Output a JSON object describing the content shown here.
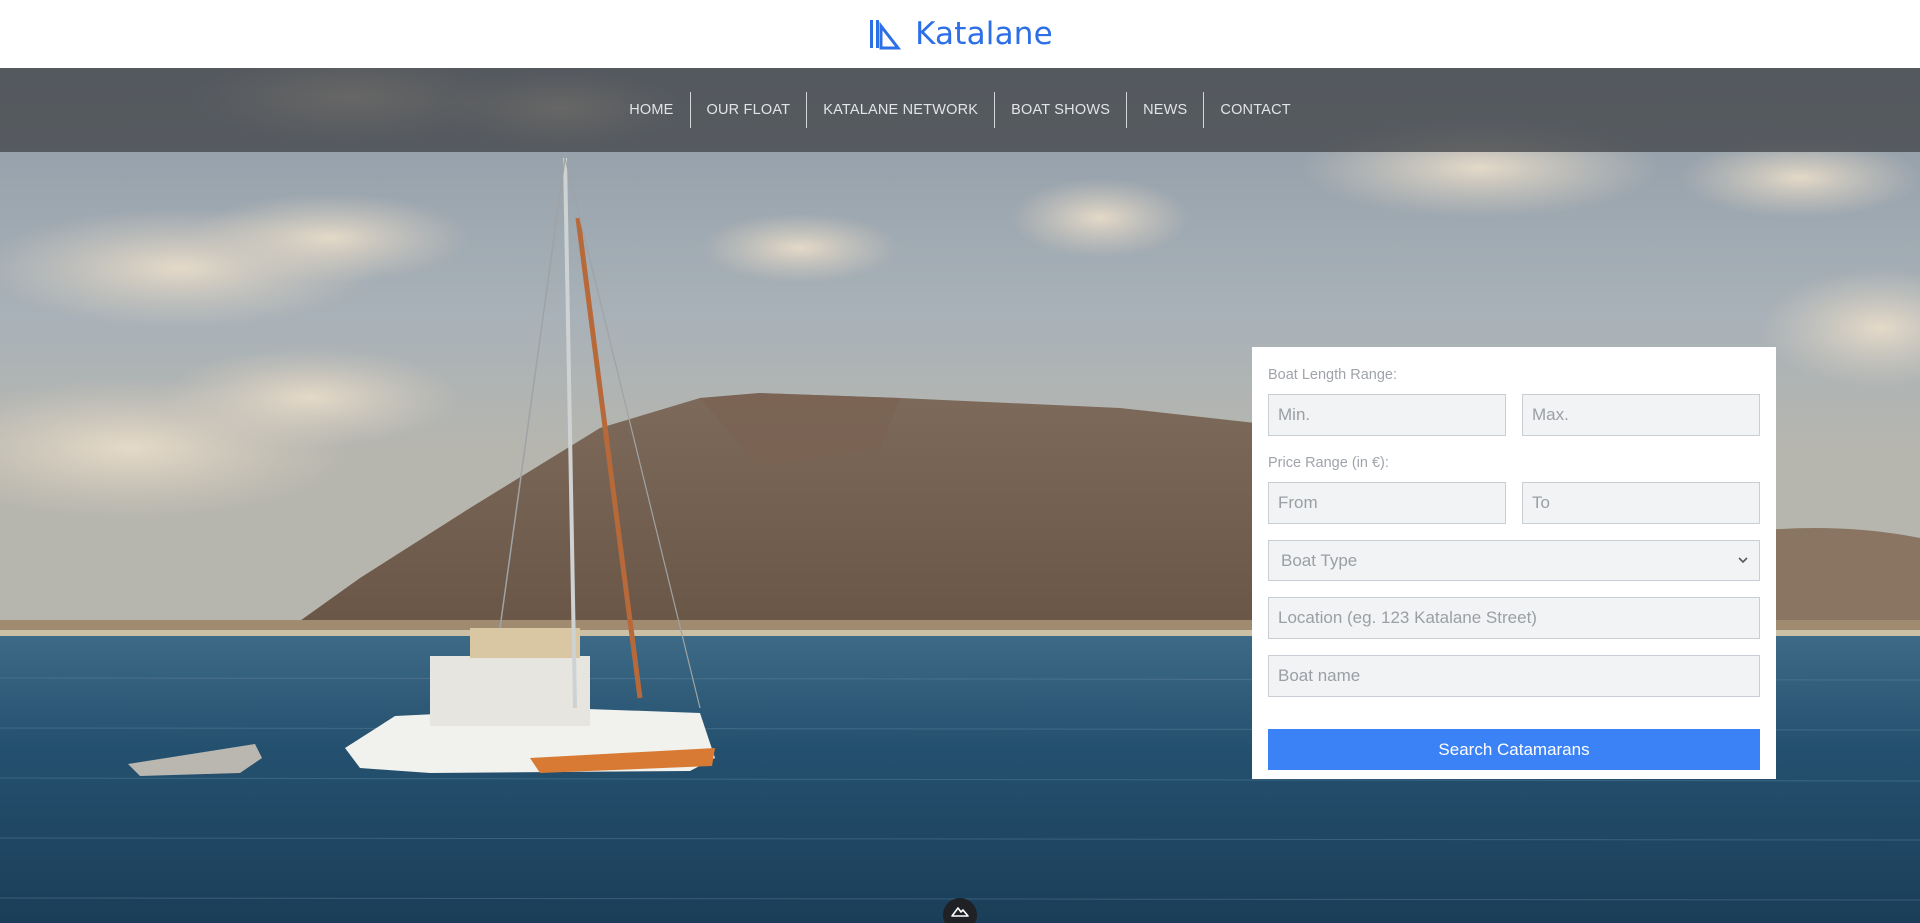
{
  "brand": {
    "name": "Katalane",
    "logo_icon": "katalane-sail-logo-icon",
    "color": "#2c6fe6"
  },
  "nav": {
    "items": [
      {
        "label": "HOME"
      },
      {
        "label": "OUR FLOAT"
      },
      {
        "label": "KATALANE NETWORK"
      },
      {
        "label": "BOAT SHOWS"
      },
      {
        "label": "NEWS"
      },
      {
        "label": "CONTACT"
      }
    ]
  },
  "search": {
    "length_label": "Boat Length Range:",
    "length_min_placeholder": "Min.",
    "length_max_placeholder": "Max.",
    "price_label": "Price Range (in €):",
    "price_from_placeholder": "From",
    "price_to_placeholder": "To",
    "boat_type_selected": "Boat Type",
    "location_placeholder": "Location (eg. 123 Katalane Street)",
    "boat_name_placeholder": "Boat name",
    "submit_label": "Search Catamarans",
    "button_color": "#3b82f6"
  },
  "hero": {
    "image": "catamaran-anchored-near-volcanic-island"
  },
  "footer_badge_icon": "mountain-logo-icon"
}
